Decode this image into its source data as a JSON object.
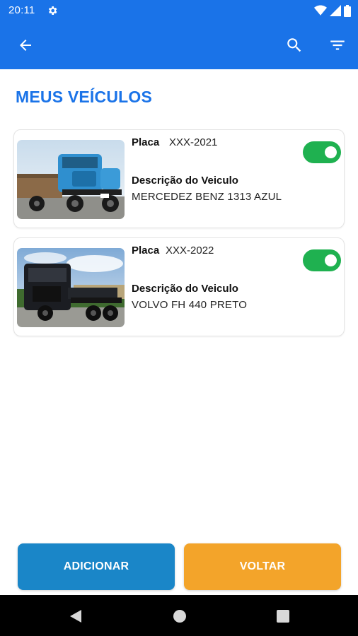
{
  "statusbar": {
    "time": "20:11",
    "icons": [
      "gear-icon",
      "wifi-icon",
      "signal-icon",
      "battery-icon"
    ]
  },
  "appbar": {
    "icons": [
      "arrow-left-icon",
      "search-icon",
      "filter-icon"
    ]
  },
  "page": {
    "title": "MEUS VEÍCULOS"
  },
  "vehicles": [
    {
      "placa_label": "Placa",
      "placa": "XXX-2021",
      "desc_label": "Descrição do Veiculo",
      "descricao": "MERCEDEZ BENZ 1313 AZUL",
      "active": true,
      "photo": "blue-truck-photo"
    },
    {
      "placa_label": "Placa",
      "placa": "XXX-2022",
      "desc_label": "Descrição do Veiculo",
      "descricao": "VOLVO FH 440 PRETO",
      "active": true,
      "photo": "black-truck-photo"
    }
  ],
  "actions": {
    "add_label": "ADICIONAR",
    "back_label": "VOLTAR"
  },
  "colors": {
    "primary": "#1a73e8",
    "toggle_on": "#1fb150",
    "add_button": "#1a86c8",
    "back_button": "#f3a42a"
  },
  "navbar": {
    "icons": [
      "nav-back-icon",
      "nav-home-icon",
      "nav-recents-icon"
    ]
  }
}
